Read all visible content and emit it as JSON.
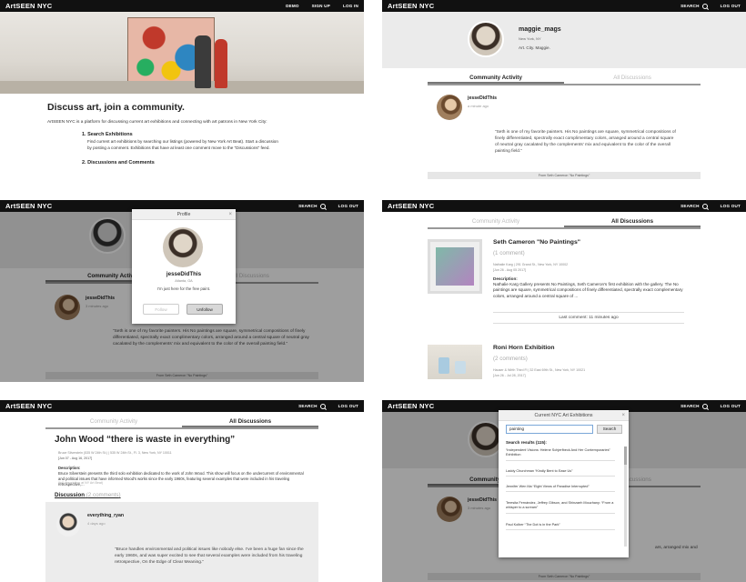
{
  "brand": "ArtSEEN NYC",
  "nav": {
    "demo": "DEMO",
    "signup": "SIGN UP",
    "login": "LOG IN",
    "search": "SEARCH",
    "logout": "LOG OUT"
  },
  "landing": {
    "heading": "Discuss art, join a community.",
    "intro": "ArtSEEN NYC is a platform for discussing current art exhibitions and connecting with art patrons in New York City:",
    "steps": [
      {
        "title": "1. Search Exhibitions",
        "body": "Find current art exhibitions by searching our listings (powered by New York Art Beat). Start a discussion by posting a comment. Exhibitions that have at least one comment move to the “Discussions” feed."
      },
      {
        "title": "2. Discussions and Comments",
        "body": ""
      }
    ]
  },
  "profile": {
    "username": "maggie_mags",
    "location": "New York, NY",
    "bio": "Art. City. Maggie."
  },
  "tabs": {
    "community": "Community Activity",
    "all": "All Discussions"
  },
  "activity": {
    "user": "jesseDidThis",
    "time_a": "a minute ago",
    "time_b": "3 minutes ago",
    "quote": "“Seth is one of my favorite painters. His No paintings are square, symmetrical compositions of finely differentiated, spectrally exact complimentary colors, arranged around a central square of neutral gray cacalated by the complements’ mix and equivalent to the color of the overall painting field.”",
    "from_prefix": "From",
    "from_title": "Seth Cameron \"No Paintings\""
  },
  "profile_modal": {
    "title": "Profile",
    "close": "×",
    "username": "jesseDidThis",
    "location": "Atlanta, GA",
    "bio": "I'm just here for the free paint.",
    "follow": "Follow",
    "unfollow": "Unfollow"
  },
  "discussions": [
    {
      "title": "Seth Cameron \"No Paintings\"",
      "count": "(1 comment)",
      "meta": "Nathalie Karg | 291 Grand St., New York, NY 10002",
      "dates": "[Jun 26 - Aug 05 2017]",
      "desc_label": "Description:",
      "desc": "Nathalie Karg Gallery presents No Paintings, Seth Cameron's first exhibition with the gallery. The No paintings are square, symmetrical compositions of finely differentiated, spectrally exact complementary colors, arranged around a central square of ...",
      "last": "Last comment: 11 minutes ago"
    },
    {
      "title": "Roni Horn Exhibition",
      "count": "(2 comments)",
      "meta": "Hauser & Wirth Third Fl | 32 East 69th St., New York, NY 10021",
      "dates": "[Jun 26 - Jul 28, 2017]"
    }
  ],
  "detail": {
    "title": "John Wood “there is waste in everything”",
    "meta": "Bruce Silverstein (535 W 24th St.) | 535 W 24th St., Fl. 3, New York, NY 10011",
    "dates": "[Jun 07 - Aug 16, 2017]",
    "desc_label": "Description:",
    "desc": "Bruce Silverstein presents the third solo exhibition dedicated to the work of John Wood. This show will focus on the undercurrent of environmental and political issues that have informed Wood's works since the early 1960s, featuring several examples that were included in his traveling retrospective,...",
    "more": "(full description at NY Art Beat)",
    "discussion": "Discussion",
    "discussion_count": "(2 comments)",
    "user": "everything_ryan",
    "time": "4 days ago",
    "quote": "“Bruce handles environmental and political issues like nobody else. I’ve been a huge fan since the early 1960s, and was super excited to see that several examples were included from his traveling retrospective, On the Edge of Clear Meaning.”"
  },
  "search_modal": {
    "title": "Current NYC Art Exhibitions",
    "close": "×",
    "query": "painting",
    "button": "Search",
    "results_label": "Search results (115):",
    "results": [
      "“Independent Visions: Helene Schjerfbeck And Her Contemporaries” Exhibition",
      "Laddy Churchman “Kindly Bent to Ease Us”",
      "Jennifer Wen Ma “Eight Views of Paradise Interrupted”",
      "Teresita Fernández, Jeffrey Gibson, and Shinzaeh Mouzhany: “From a whisper to a scream”",
      "Paul Kolber “The Dot is in the Park”"
    ],
    "behind_text": "ars, arranged mix and"
  }
}
